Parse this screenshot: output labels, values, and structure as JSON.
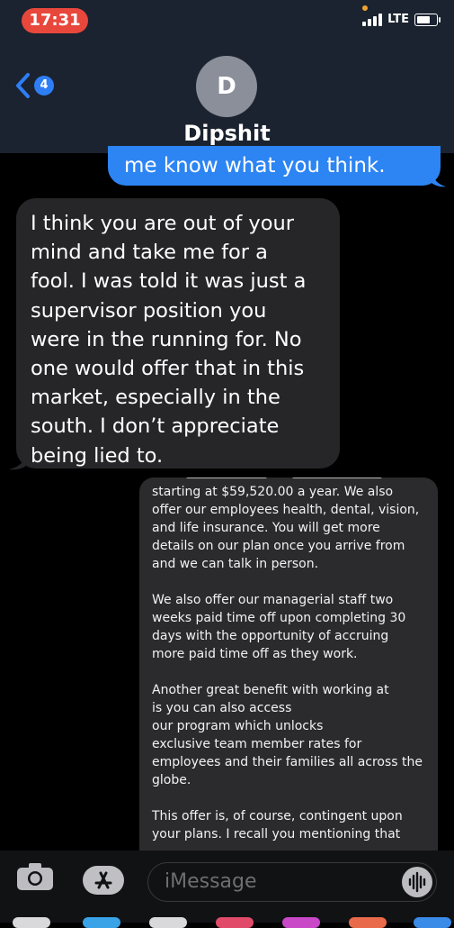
{
  "status_bar": {
    "time": "17:31",
    "network": "LTE"
  },
  "header": {
    "back_badge_count": "4",
    "avatar_initial": "D",
    "contact_name": "Dipshit"
  },
  "messages": {
    "sent_partial": "me know what you think.",
    "received": "I think you are out of your\nmind and take me for a\nfool. I was told it was just a\nsupervisor position you\nwere in the running for. No\none would offer that in this\nmarket, especially in the\nsouth. I don’t appreciate\nbeing lied to.",
    "screenshot_text": "starting at $59,520.00 a year. We also\noffer our employees health, dental, vision,\nand life insurance. You will get more\ndetails on our plan once you arrive from\n               and we can talk in person.\n\nWe also offer our managerial staff two\nweeks paid time off upon completing 30\ndays with the opportunity of accruing\nmore paid time off as they work.\n\nAnother great benefit with working at\n                     is you can also access\nour                   program which unlocks\nexclusive team member rates for\nemployees and their families all across the\nglobe.\n\nThis offer is, of course, contingent upon\nyour plans. I recall you mentioning that"
  },
  "composer": {
    "placeholder": "iMessage"
  },
  "icons": {
    "back": "chevron-left-icon",
    "camera": "camera-icon",
    "appstore": "app-store-icon",
    "audio": "waveform-icon"
  },
  "colors": {
    "header_bg": "#1b2330",
    "sent_bubble": "#2c85f3",
    "received_bubble": "#262629",
    "time_pill": "#e8473c",
    "badge": "#2e7ef5"
  }
}
